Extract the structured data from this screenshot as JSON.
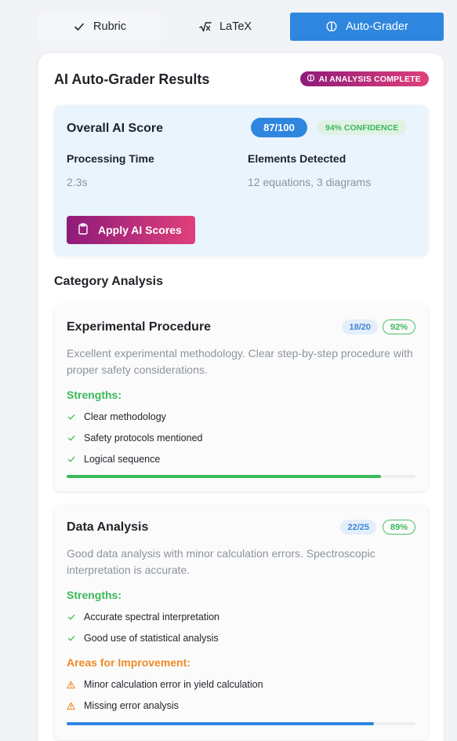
{
  "tabs": [
    {
      "label": "Rubric",
      "icon": "check-icon"
    },
    {
      "label": "LaTeX",
      "icon": "sqrt-x-icon"
    },
    {
      "label": "Auto-Grader",
      "icon": "brain-icon",
      "active": true
    }
  ],
  "results": {
    "title": "AI Auto-Grader Results",
    "status_badge": "AI ANALYSIS COMPLETE"
  },
  "overall": {
    "label": "Overall AI Score",
    "score": "87/100",
    "confidence": "94% CONFIDENCE",
    "processing_time_label": "Processing Time",
    "processing_time": "2.3s",
    "elements_label": "Elements Detected",
    "elements": "12 equations, 3 diagrams",
    "apply_button": "Apply AI Scores"
  },
  "category_section_title": "Category Analysis",
  "categories": [
    {
      "title": "Experimental Procedure",
      "score": "18/20",
      "percent": "92%",
      "progress": 0.9,
      "description": "Excellent experimental methodology. Clear step-by-step procedure with proper safety considerations.",
      "strengths_label": "Strengths:",
      "strengths": [
        "Clear methodology",
        "Safety protocols mentioned",
        "Logical sequence"
      ]
    },
    {
      "title": "Data Analysis",
      "score": "22/25",
      "percent": "89%",
      "progress": 0.88,
      "description": "Good data analysis with minor calculation errors. Spectroscopic interpretation is accurate.",
      "strengths_label": "Strengths:",
      "strengths": [
        "Accurate spectral interpretation",
        "Good use of statistical analysis"
      ],
      "improvements_label": "Areas for Improvement:",
      "improvements": [
        "Minor calculation error in yield calculation",
        "Missing error analysis"
      ]
    }
  ],
  "colors": {
    "accent_blue": "#2e86de",
    "success_green": "#3cb95a",
    "warning_orange": "#f08a24",
    "gradient_start": "#8e1b7a",
    "gradient_end": "#e0407a"
  }
}
